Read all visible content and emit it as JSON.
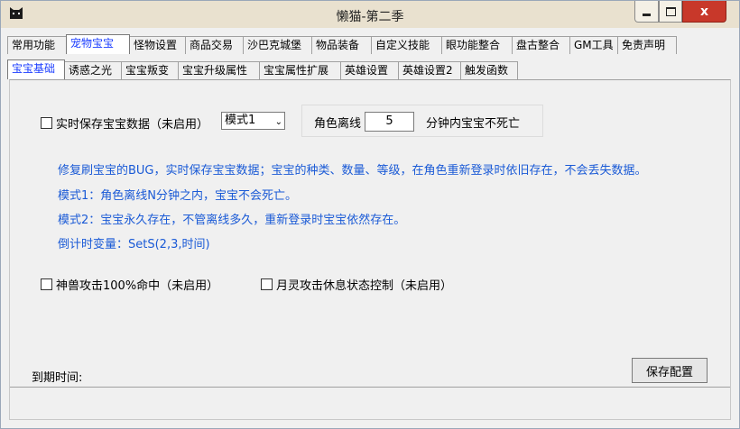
{
  "window": {
    "title": "懒猫-第二季",
    "close_symbol": "x"
  },
  "tabs_primary": [
    {
      "label": "常用功能"
    },
    {
      "label": "宠物宝宝"
    },
    {
      "label": "怪物设置"
    },
    {
      "label": "商品交易"
    },
    {
      "label": "沙巴克城堡"
    },
    {
      "label": "物品装备"
    },
    {
      "label": "自定义技能"
    },
    {
      "label": "眼功能整合"
    },
    {
      "label": "盘古整合"
    },
    {
      "label": "GM工具"
    },
    {
      "label": "免责声明"
    }
  ],
  "tabs_secondary": [
    {
      "label": "宝宝基础"
    },
    {
      "label": "诱惑之光"
    },
    {
      "label": "宝宝叛变"
    },
    {
      "label": "宝宝升级属性"
    },
    {
      "label": "宝宝属性扩展"
    },
    {
      "label": "英雄设置"
    },
    {
      "label": "英雄设置2"
    },
    {
      "label": "触发函数"
    }
  ],
  "panel": {
    "realtime_save_label": "实时保存宝宝数据（未启用）",
    "mode_select": {
      "value": "模式1",
      "arrow": "⌄"
    },
    "offline_label": "角色离线",
    "offline_minutes": "5",
    "offline_suffix": "分钟内宝宝不死亡",
    "info_lines": [
      "修复刷宝宝的BUG，实时保存宝宝数据；宝宝的种类、数量、等级，在角色重新登录时依旧存在，不会丢失数据。",
      "模式1：角色离线N分钟之内，宝宝不会死亡。",
      "模式2：宝宝永久存在，不管离线多久，重新登录时宝宝依然存在。",
      "倒计时变量：SetS(2,3,时间)"
    ],
    "beast_hit_label": "神兽攻击100%命中（未启用）",
    "moon_spirit_label": "月灵攻击休息状态控制（未启用）"
  },
  "footer": {
    "expire_label": "到期时间:",
    "save_button": "保存配置"
  },
  "colors": {
    "active_tab_text": "#1a3cff",
    "info_text": "#1a5ad6",
    "close_button": "#c8382a",
    "titlebar": "#e9e1cf"
  }
}
